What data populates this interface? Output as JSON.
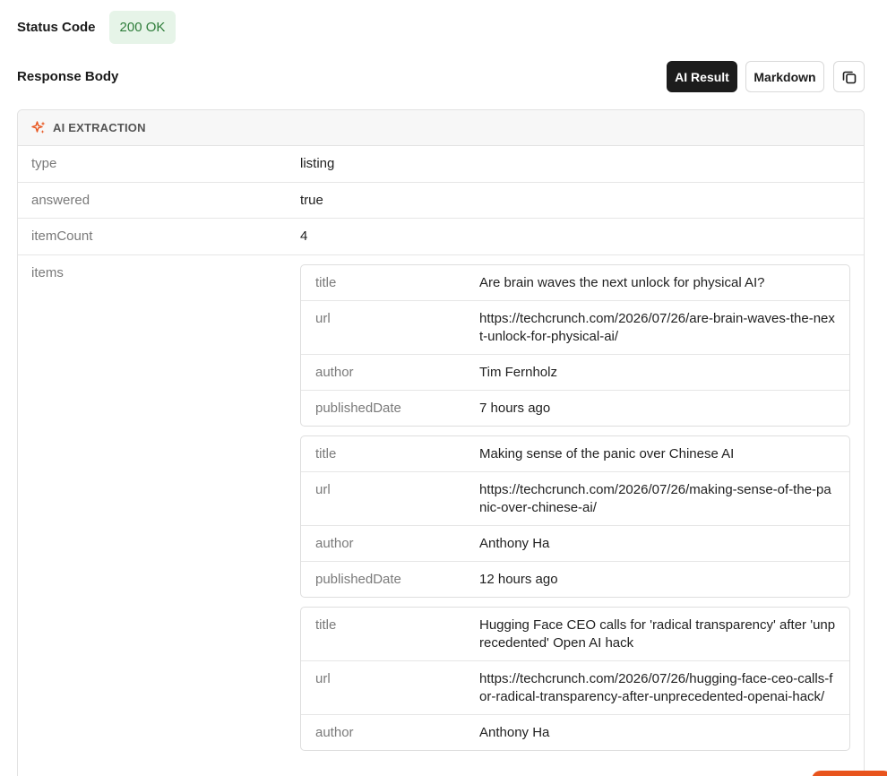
{
  "status": {
    "label": "Status Code",
    "badge": "200 OK"
  },
  "response": {
    "label": "Response Body",
    "buttons": {
      "ai_result": "AI Result",
      "markdown": "Markdown"
    },
    "copy_icon": "copy-icon"
  },
  "panel": {
    "title": "AI EXTRACTION",
    "icon": "sparkle-icon",
    "fields": [
      {
        "key": "type",
        "value": "listing"
      },
      {
        "key": "answered",
        "value": "true"
      },
      {
        "key": "itemCount",
        "value": "4"
      }
    ],
    "items_label": "items",
    "item_keys": {
      "title": "title",
      "url": "url",
      "author": "author",
      "publishedDate": "publishedDate"
    },
    "items": [
      {
        "title": "Are brain waves the next unlock for physical AI?",
        "url": "https://techcrunch.com/2026/07/26/are-brain-waves-the-next-unlock-for-physical-ai/",
        "author": "Tim Fernholz",
        "publishedDate": "7 hours ago"
      },
      {
        "title": "Making sense of the panic over Chinese AI",
        "url": "https://techcrunch.com/2026/07/26/making-sense-of-the-panic-over-chinese-ai/",
        "author": "Anthony Ha",
        "publishedDate": "12 hours ago"
      },
      {
        "title": "Hugging Face CEO calls for 'radical transparency' after 'unprecedented' Open AI hack",
        "url": "https://techcrunch.com/2026/07/26/hugging-face-ceo-calls-for-radical-transparency-after-unprecedented-openai-hack/",
        "author": "Anthony Ha",
        "publishedDate": ""
      }
    ]
  },
  "colors": {
    "accent": "#e8541d",
    "badge_bg": "#e6f4e8",
    "badge_text": "#2e7d3a",
    "dark_button": "#1c1c1c"
  }
}
